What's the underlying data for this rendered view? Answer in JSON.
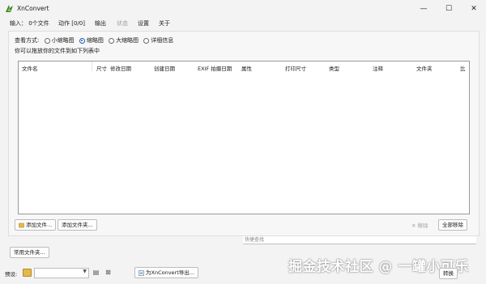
{
  "window": {
    "title": "XnConvert",
    "controls": {
      "minimize": "—",
      "maximize": "☐",
      "close": "✕"
    }
  },
  "tabs": [
    {
      "label": "输入： 0个文件",
      "state": "active"
    },
    {
      "label": "动作 [0/0]",
      "state": "normal"
    },
    {
      "label": "输出",
      "state": "normal"
    },
    {
      "label": "状态",
      "state": "disabled"
    },
    {
      "label": "设置",
      "state": "normal"
    },
    {
      "label": "关于",
      "state": "normal"
    }
  ],
  "view": {
    "label": "查看方式:",
    "options": [
      {
        "label": "小缩略图",
        "selected": false
      },
      {
        "label": "缩略图",
        "selected": true
      },
      {
        "label": "大缩略图",
        "selected": false
      },
      {
        "label": "详细信息",
        "selected": false
      }
    ],
    "hint": "你可以拖放你的文件到如下列表中"
  },
  "file_list": {
    "columns": [
      "文件名",
      "尺寸",
      "修改日期",
      "创建日期",
      "EXIF 拍摄日期",
      "属性",
      "打印尺寸",
      "类型",
      "注释",
      "文件夹",
      "比"
    ]
  },
  "buttons": {
    "add_files": "添加文件...",
    "add_folder": "添加文件夹...",
    "remove": "移除",
    "remove_all": "全部移除",
    "favorite_folders": "常用文件夹...",
    "export": "为XnConvert导出...",
    "convert": "转换"
  },
  "sort": {
    "placeholder": "快捷查找"
  },
  "preset": {
    "label": "预设:",
    "value": ""
  },
  "watermark": "掘金技术社区 @ 一罐小可乐",
  "colors": {
    "accent": "#1a5fb4",
    "icon_folder": "#e6b84a",
    "app_icon": "#3a7d2c"
  },
  "icons": [
    "app-icon",
    "folder-add-icon",
    "save-icon",
    "delete-icon",
    "export-icon"
  ]
}
